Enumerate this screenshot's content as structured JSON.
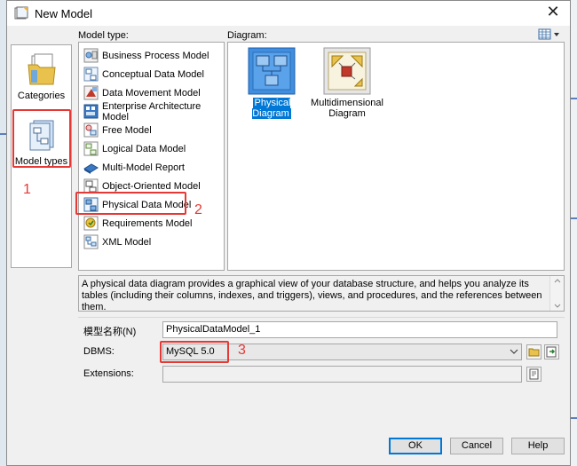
{
  "window": {
    "title": "New Model",
    "close_glyph": "✕"
  },
  "categories": [
    {
      "label": "Categories",
      "icon": "folder-icon",
      "selected": false
    },
    {
      "label": "Model types",
      "icon": "model-types-icon",
      "selected": true
    }
  ],
  "model_type": {
    "label": "Model type:",
    "items": [
      {
        "label": "Business Process Model",
        "icon": "business-process-icon"
      },
      {
        "label": "Conceptual Data Model",
        "icon": "conceptual-data-icon"
      },
      {
        "label": "Data Movement Model",
        "icon": "data-movement-icon"
      },
      {
        "label": "Enterprise Architecture Model",
        "icon": "enterprise-architecture-icon"
      },
      {
        "label": "Free Model",
        "icon": "free-model-icon"
      },
      {
        "label": "Logical Data Model",
        "icon": "logical-data-icon"
      },
      {
        "label": "Multi-Model Report",
        "icon": "multi-model-report-icon"
      },
      {
        "label": "Object-Oriented Model",
        "icon": "object-oriented-icon"
      },
      {
        "label": "Physical Data Model",
        "icon": "physical-data-icon"
      },
      {
        "label": "Requirements Model",
        "icon": "requirements-icon"
      },
      {
        "label": "XML Model",
        "icon": "xml-model-icon"
      }
    ],
    "selected": "Physical Data Model"
  },
  "diagram": {
    "label": "Diagram:",
    "items": [
      {
        "label": "Physical Diagram",
        "selected": true
      },
      {
        "label": "Multidimensional Diagram",
        "selected": false
      }
    ]
  },
  "description": "A physical data diagram provides a graphical view of your database structure, and helps you analyze its tables (including their columns, indexes, and triggers), views, and procedures, and the references between them.",
  "form": {
    "name_label": "模型名称(N)",
    "name_value": "PhysicalDataModel_1",
    "dbms_label": "DBMS:",
    "dbms_value": "MySQL 5.0",
    "extensions_label": "Extensions:",
    "extensions_value": ""
  },
  "buttons": {
    "ok": "OK",
    "cancel": "Cancel",
    "help": "Help"
  },
  "annotations": {
    "n1": "1",
    "n2": "2",
    "n3": "3"
  },
  "colors": {
    "highlight_red": "#e53935",
    "selection_blue": "#0078d7"
  }
}
